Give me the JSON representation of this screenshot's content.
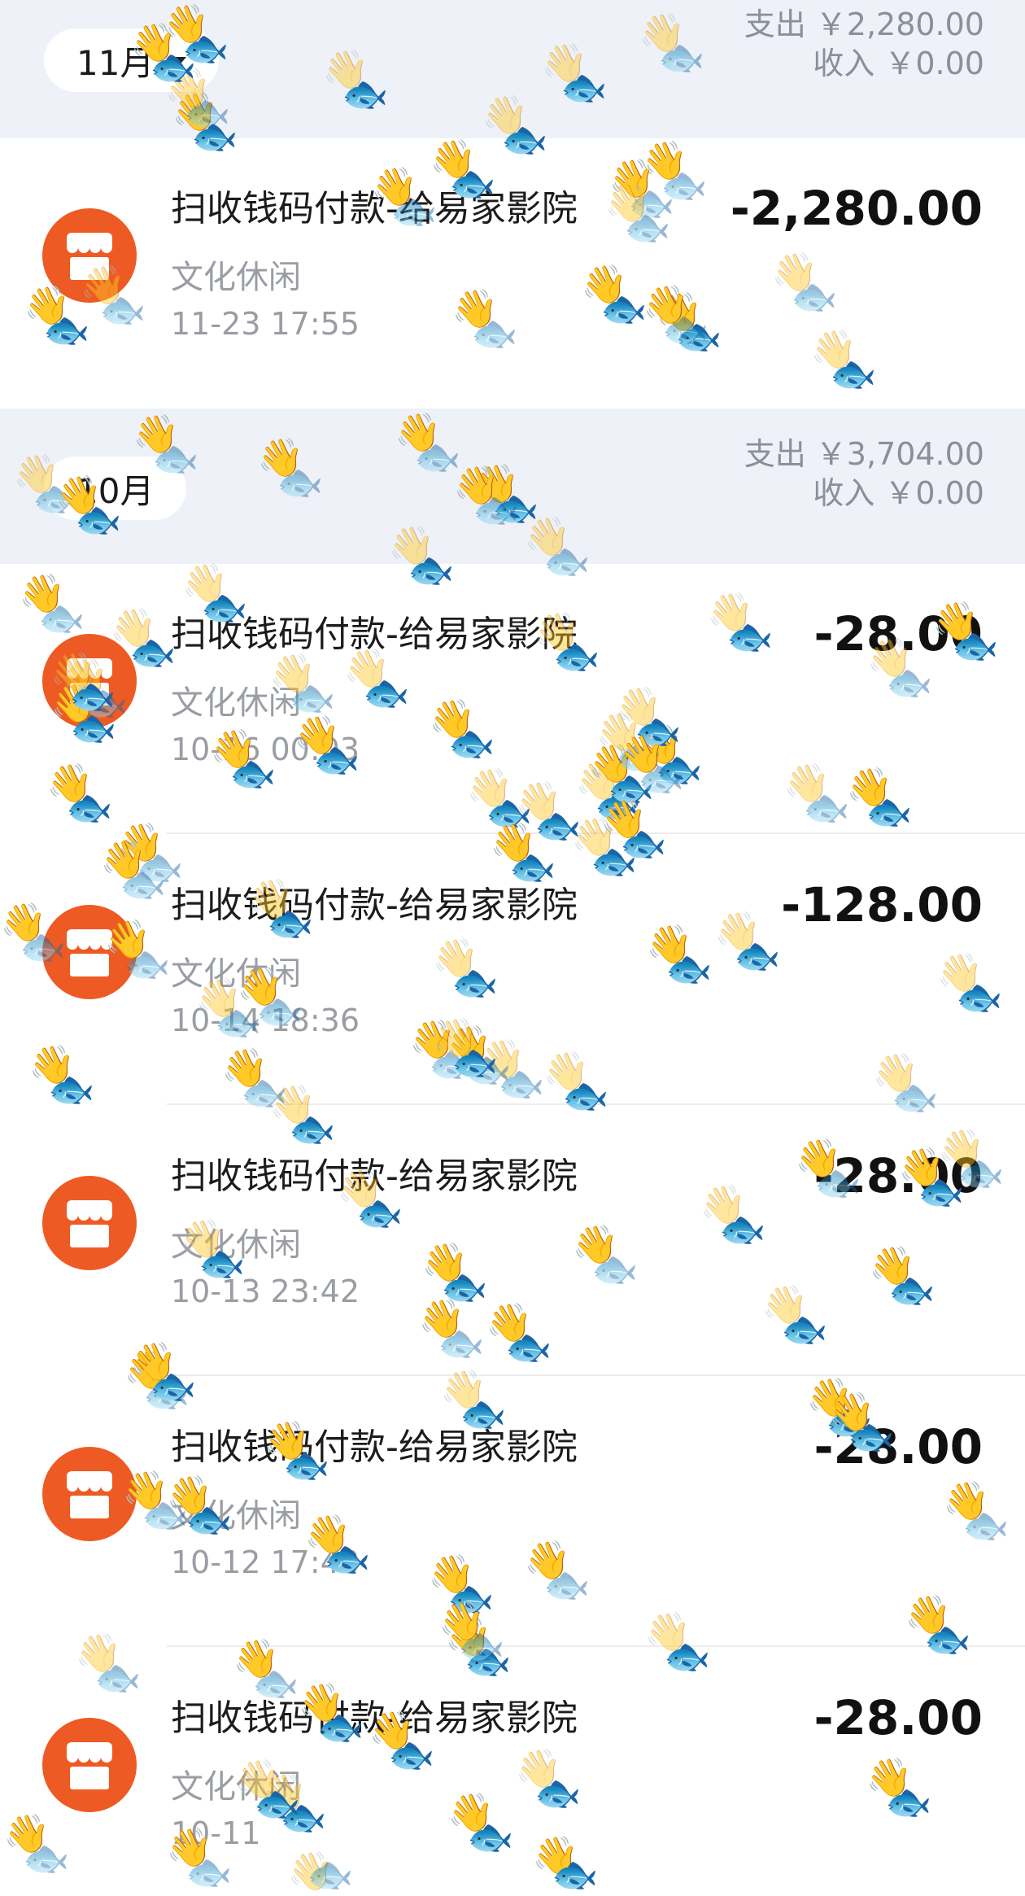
{
  "sections": [
    {
      "month": "11月",
      "expense": "支出 ￥2,280.00",
      "income": "收入 ￥0.00",
      "transactions": [
        {
          "title": "扫收钱码付款-给易家影院",
          "category": "文化休闲",
          "time": "11-23 17:55",
          "amount": "-2,280.00"
        }
      ]
    },
    {
      "month": "10月",
      "expense": "支出 ￥3,704.00",
      "income": "收入 ￥0.00",
      "transactions": [
        {
          "title": "扫收钱码付款-给易家影院",
          "category": "文化休闲",
          "time": "10-16 00:03",
          "amount": "-28.00"
        },
        {
          "title": "扫收钱码付款-给易家影院",
          "category": "文化休闲",
          "time": "10-14 18:36",
          "amount": "-128.00"
        },
        {
          "title": "扫收钱码付款-给易家影院",
          "category": "文化休闲",
          "time": "10-13 23:42",
          "amount": "-28.00"
        },
        {
          "title": "扫收钱码付款-给易家影院",
          "category": "文化休闲",
          "time": "10-12 17:43",
          "amount": "-28.00"
        },
        {
          "title": "扫收钱码付款-给易家影院",
          "category": "文化休闲",
          "time": "10-11",
          "amount": "-28.00"
        }
      ]
    }
  ],
  "icons": {
    "merchant": "shop-icon",
    "dropdown": "chevron-down-icon",
    "overlay": [
      "waving-hand-icon",
      "fish-icon"
    ]
  },
  "colors": {
    "merchant_icon_bg": "#ee5a24",
    "section_header_bg": "#eef1f7",
    "amount_text": "#111111",
    "secondary_text": "#9a9da3"
  }
}
